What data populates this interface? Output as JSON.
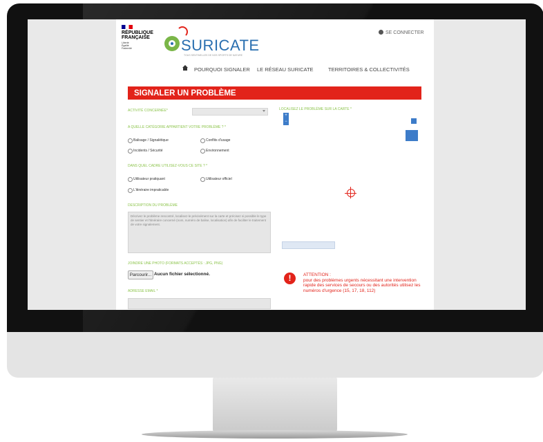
{
  "site": {
    "gov_name": "RÉPUBLIQUE FRANÇAISE",
    "gov_motto": "Liberté Égalité Fraternité",
    "logo_text": "SURICATE",
    "logo_tagline": "TOUS SENTINELLES DE NOS SPORTS DE NATURE",
    "login_label": "SE CONNECTER"
  },
  "nav": {
    "items": [
      "POURQUOI SIGNALER",
      "LE RÉSEAU SURICATE",
      "TERRITOIRES & COLLECTIVITÉS"
    ]
  },
  "form": {
    "title": "SIGNALER UN PROBLÈME",
    "activity_label": "ACTIVITÉ CONCERNÉE*",
    "category_label": "A QUELLE CATÉGORIE APPARTIENT VOTRE PROBLÈME ? *",
    "categories": [
      "Balisage / Signalétique",
      "Conflits d'usage",
      "Incidents / Sécurité",
      "Environnement"
    ],
    "practice_label": "DANS QUEL CADRE UTILISEZ-VOUS CE SITE ? *",
    "practices": [
      "Utilisateur pratiquant",
      "Utilisateur officiel",
      "L'itinéraire impraticable"
    ],
    "description_label": "DESCRIPTION DU PROBLÈME",
    "description_placeholder": "Décrivez le problème rencontré, localisez-le précisément sur la carte et précisez si possible le type de sentier et l'itinéraire concerné (nom, numéro de balise, localisation) afin de faciliter le traitement de votre signalement.",
    "attach_label": "JOINDRE UNE PHOTO (FORMATS ACCEPTÉS : JPG, PNG)",
    "browse_label": "Parcourir...",
    "no_file_label": "Aucun fichier sélectionné.",
    "email_label": "ADRESSE EMAIL *"
  },
  "map": {
    "label": "LOCALISEZ LE PROBLÈME SUR LA CARTE *",
    "zoom_in": "+",
    "zoom_out": "−"
  },
  "alert": {
    "icon": "!",
    "title": "ATTENTION :",
    "text": "pour des problèmes urgents nécessitant une intervention rapide des services de secours ou des autorités utilisez les numéros d'urgence (15, 17, 18, 112)"
  },
  "colors": {
    "banner_red": "#e2231a",
    "label_green": "#8bc34a",
    "brand_blue": "#2a6fb0",
    "map_control_blue": "#3d7cc9"
  }
}
